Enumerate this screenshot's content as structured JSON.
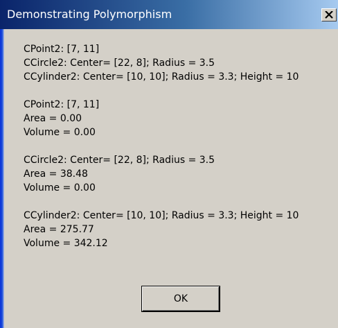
{
  "window": {
    "title": "Demonstrating Polymorphism"
  },
  "icons": {
    "close": "close-icon"
  },
  "message": {
    "group1": [
      "CPoint2: [7, 11]",
      "CCircle2: Center= [22, 8]; Radius = 3.5",
      "CCylinder2: Center= [10, 10]; Radius = 3.3; Height = 10"
    ],
    "group2": [
      "CPoint2: [7, 11]",
      "Area = 0.00",
      "Volume = 0.00"
    ],
    "group3": [
      "CCircle2: Center= [22, 8]; Radius = 3.5",
      "Area = 38.48",
      "Volume = 0.00"
    ],
    "group4": [
      "CCylinder2: Center= [10, 10]; Radius = 3.3; Height = 10",
      "Area = 275.77",
      "Volume = 342.12"
    ]
  },
  "buttons": {
    "ok_label": "OK"
  },
  "colors": {
    "title_bar_start": "#0a246a",
    "title_bar_end": "#a6caf0",
    "dialog_face": "#d4d0c8"
  }
}
